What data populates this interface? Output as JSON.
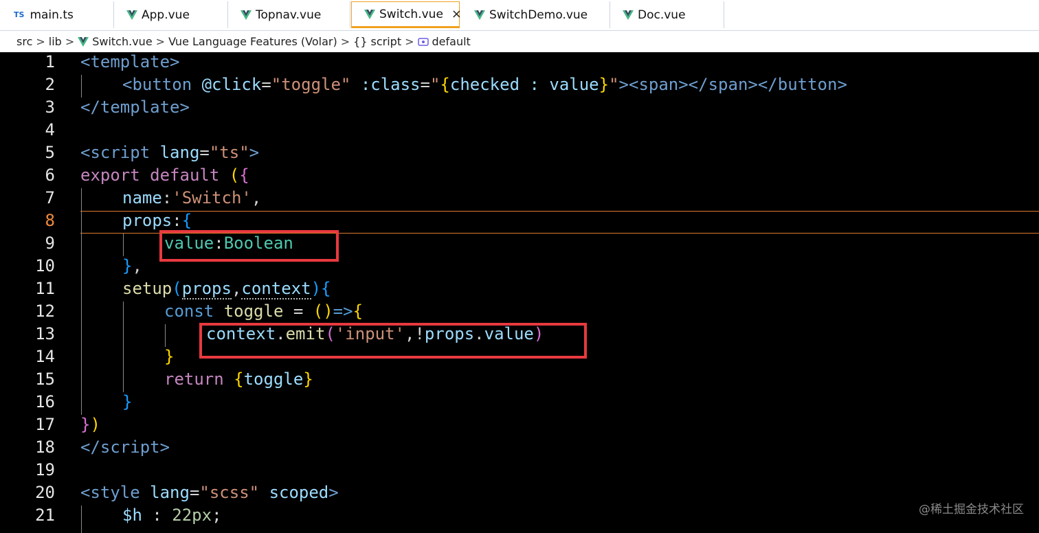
{
  "tabs": [
    {
      "label": "main.ts",
      "icon": "TS"
    },
    {
      "label": "App.vue",
      "icon": "vue-icon"
    },
    {
      "label": "Topnav.vue",
      "icon": "vue-icon"
    },
    {
      "label": "Switch.vue",
      "icon": "vue-icon",
      "active": true,
      "close": "×"
    },
    {
      "label": "SwitchDemo.vue",
      "icon": "vue-icon"
    },
    {
      "label": "Doc.vue",
      "icon": "vue-icon"
    }
  ],
  "breadcrumb": {
    "src": "src",
    "lib": "lib",
    "file": "Switch.vue",
    "ext": "Vue Language Features (Volar)",
    "braces": "{}",
    "script": "script",
    "default": "default",
    "sep": ">"
  },
  "lines": [
    "1",
    "2",
    "3",
    "4",
    "5",
    "6",
    "7",
    "8",
    "9",
    "10",
    "11",
    "12",
    "13",
    "14",
    "15",
    "16",
    "17",
    "18",
    "19",
    "20",
    "21"
  ],
  "code": {
    "l1": [
      "<",
      "template",
      ">"
    ],
    "l2": [
      "<",
      "button",
      " ",
      "@click",
      "=",
      "\"toggle\"",
      " ",
      ":class",
      "=",
      "\"",
      "{",
      "checked : value",
      "}",
      "\"",
      "><",
      "span",
      "></",
      "span",
      "></",
      "button",
      ">"
    ],
    "l3": [
      "</",
      "template",
      ">"
    ],
    "l5": [
      "<",
      "script",
      " ",
      "lang",
      "=",
      "\"ts\"",
      ">"
    ],
    "l6": [
      "export",
      " ",
      "default",
      " ",
      "(",
      "{"
    ],
    "l7": [
      "name",
      ":",
      "'Switch'",
      ","
    ],
    "l8": [
      "props",
      ":",
      "{"
    ],
    "l9": [
      "value",
      ":",
      "Boolean"
    ],
    "l10": [
      "}",
      ","
    ],
    "l11": [
      "setup",
      "(",
      "props",
      ",",
      "context",
      ")",
      "{"
    ],
    "l12": [
      "const",
      " ",
      "toggle",
      " = ",
      "()",
      "=>",
      "{"
    ],
    "l13": [
      "context",
      ".",
      "emit",
      "(",
      "'input'",
      ",!",
      "props",
      ".",
      "value",
      ")"
    ],
    "l14": [
      "}"
    ],
    "l15": [
      "return",
      " ",
      "{",
      "toggle",
      "}"
    ],
    "l16": [
      "}"
    ],
    "l17": [
      "}",
      ")"
    ],
    "l18": [
      "</",
      "script",
      ">"
    ],
    "l20": [
      "<",
      "style",
      " ",
      "lang",
      "=",
      "\"scss\"",
      " ",
      "scoped",
      ">"
    ],
    "l21": [
      "$h",
      " : ",
      "22px",
      ";"
    ]
  },
  "watermark": "@稀土掘金技术社区",
  "colors": {
    "highlight_box": "#e8393f",
    "active_tab_border": "#f0a020",
    "current_line_number": "#f08a3c"
  }
}
